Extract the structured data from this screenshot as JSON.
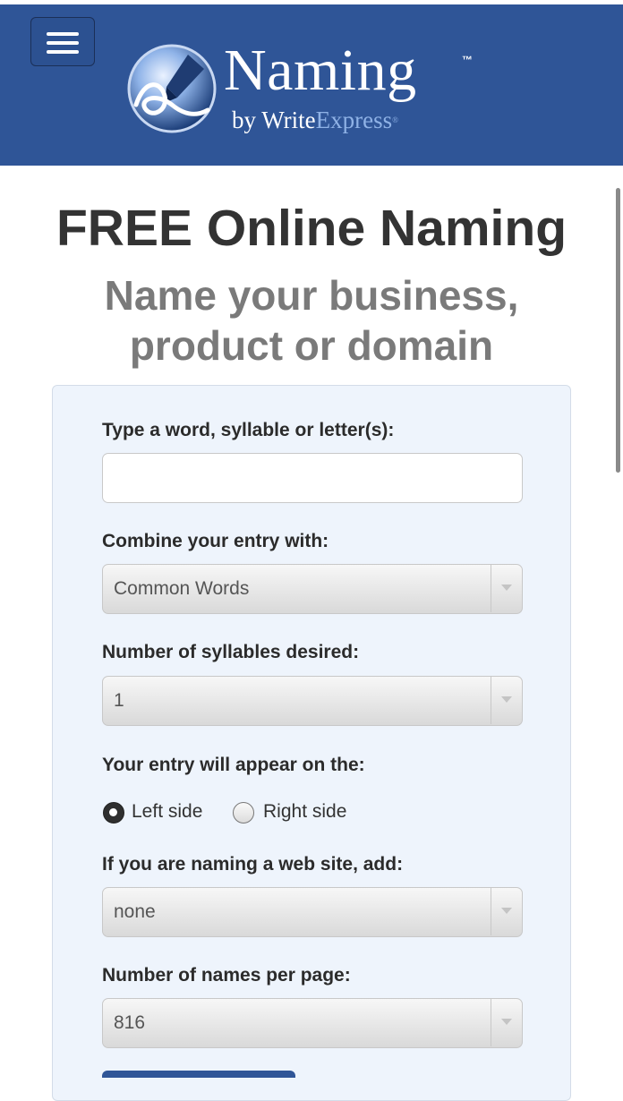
{
  "header": {
    "logo_title": "Naming",
    "logo_tm": "™",
    "logo_sub_by": "by Write",
    "logo_sub_express": "Express",
    "logo_sub_reg": "®",
    "colors": {
      "header_bg": "#2f5597",
      "express_text": "#8fb2e6"
    }
  },
  "page": {
    "title": "FREE Online Naming",
    "subtitle": "Name your business, product or domain"
  },
  "form": {
    "word_label": "Type a word, syllable or letter(s):",
    "word_value": "",
    "combine_label": "Combine your entry with:",
    "combine_value": "Common Words",
    "syllables_label": "Number of syllables desired:",
    "syllables_value": "1",
    "position_label": "Your entry will appear on the:",
    "position_options": [
      {
        "label": "Left side",
        "checked": true
      },
      {
        "label": "Right side",
        "checked": false
      }
    ],
    "website_label": "If you are naming a web site, add:",
    "website_value": "none",
    "per_page_label": "Number of names per page:",
    "per_page_value": "816"
  },
  "icons": [
    "menu-icon",
    "fountain-pen-logo-icon",
    "chevron-down-icon"
  ]
}
